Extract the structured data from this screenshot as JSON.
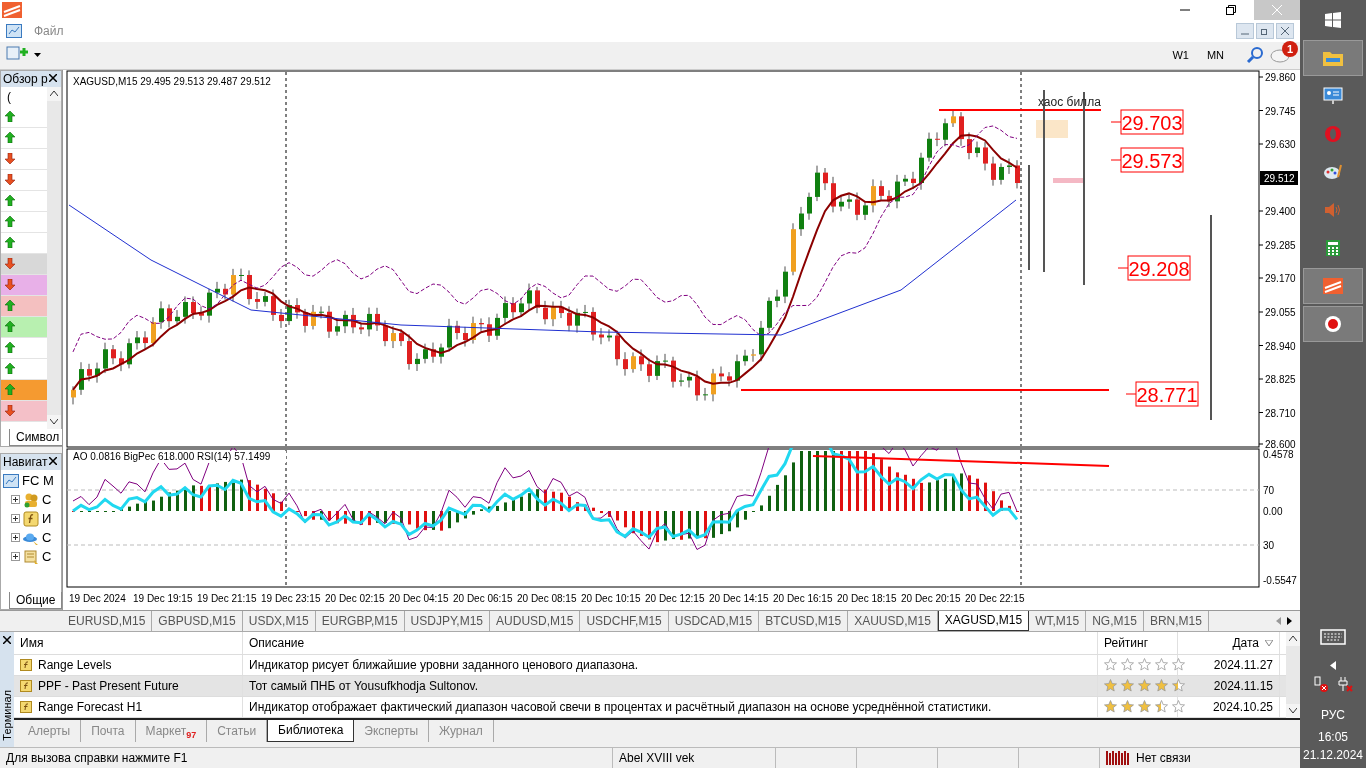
{
  "menu": [
    {
      "label": "Файл"
    }
  ],
  "toolbar": {
    "timeframes": [
      {
        "label": "W1",
        "selected": false
      },
      {
        "label": "MN",
        "selected": false
      }
    ],
    "notification_count": "1"
  },
  "market_watch": {
    "title": "Обзор р",
    "column_1": "(",
    "tab": "Символ",
    "rows": [
      {
        "kind": "up",
        "color": "#ffffff"
      },
      {
        "kind": "up",
        "color": "#ffffff"
      },
      {
        "kind": "down",
        "color": "#ffffff"
      },
      {
        "kind": "down",
        "color": "#ffffff"
      },
      {
        "kind": "up",
        "color": "#ffffff"
      },
      {
        "kind": "up",
        "color": "#ffffff"
      },
      {
        "kind": "up",
        "color": "#ffffff"
      },
      {
        "kind": "down",
        "color": "#d8d8d8"
      },
      {
        "kind": "down",
        "color": "#e8b0e8"
      },
      {
        "kind": "up",
        "color": "#f4c0c0"
      },
      {
        "kind": "up",
        "color": "#b8f0b0"
      },
      {
        "kind": "up",
        "color": "#ffffff"
      },
      {
        "kind": "up",
        "color": "#ffffff"
      },
      {
        "kind": "up",
        "color": "#f59a30"
      },
      {
        "kind": "down",
        "color": "#f4c0c8"
      }
    ]
  },
  "navigator": {
    "title": "Навигат",
    "tab": "Общие",
    "tree": [
      {
        "label": "FC M",
        "kind": "terminal",
        "children": [
          {
            "label": "С",
            "kind": "accounts",
            "expanded": false
          },
          {
            "label": "И",
            "kind": "indicators",
            "expanded": false
          },
          {
            "label": "С",
            "kind": "experts",
            "expanded": false
          },
          {
            "label": "С",
            "kind": "scripts",
            "expanded": false
          }
        ]
      }
    ]
  },
  "chart": {
    "header": "XAGUSD,M15  29.495 29.513 29.487 29.512",
    "price_ticks": [
      "29.860",
      "29.745",
      "29.630",
      "29.400",
      "29.285",
      "29.170",
      "29.055",
      "28.940",
      "28.825",
      "28.710",
      "28.600"
    ],
    "current_price": "29.512",
    "level_labels": [
      "29.703",
      "29.573",
      "29.208",
      "28.771"
    ],
    "annotation": "хаос билла",
    "indicator_header": "AO 0.0816  BigPec 618.000  RSI(14) 57.1499",
    "indicator_ticks": [
      "0.4578",
      "70",
      "0.00",
      "30",
      "-0.5547"
    ],
    "time_labels": [
      "19 Dec 2024",
      "19 Dec 19:15",
      "19 Dec 21:15",
      "19 Dec 23:15",
      "20 Dec 02:15",
      "20 Dec 04:15",
      "20 Dec 06:15",
      "20 Dec 08:15",
      "20 Dec 10:15",
      "20 Dec 12:15",
      "20 Dec 14:15",
      "20 Dec 16:15",
      "20 Dec 18:15",
      "20 Dec 20:15",
      "20 Dec 22:15"
    ]
  },
  "chart_tabs": [
    {
      "label": "EURUSD,M15",
      "selected": false
    },
    {
      "label": "GBPUSD,M15",
      "selected": false
    },
    {
      "label": "USDX,M15",
      "selected": false
    },
    {
      "label": "EURGBP,M15",
      "selected": false
    },
    {
      "label": "USDJPY,M15",
      "selected": false
    },
    {
      "label": "AUDUSD,M15",
      "selected": false
    },
    {
      "label": "USDCHF,M15",
      "selected": false
    },
    {
      "label": "USDCAD,M15",
      "selected": false
    },
    {
      "label": "BTCUSD,M15",
      "selected": false
    },
    {
      "label": "XAUUSD,M15",
      "selected": false
    },
    {
      "label": "XAGUSD,M15",
      "selected": true
    },
    {
      "label": "WT,M15",
      "selected": false
    },
    {
      "label": "NG,M15",
      "selected": false
    },
    {
      "label": "BRN,M15",
      "selected": false
    }
  ],
  "terminal": {
    "side_label": "Терминал",
    "columns": [
      "Имя",
      "Описание",
      "Рейтинг",
      "Дата"
    ],
    "rows": [
      {
        "name": "Range Levels",
        "description": "Индикатор рисует ближайшие уровни заданного ценового диапазона.",
        "stars": 0,
        "date": "2024.11.27",
        "selected": false
      },
      {
        "name": "PPF - Past Present Future",
        "description": "Тот самый ПНБ от Yousufkhodja Sultonov.",
        "stars": 4.5,
        "date": "2024.11.15",
        "selected": true
      },
      {
        "name": "Range Forecast H1",
        "description": "Индикатор отображает фактический диапазон часовой свечи в процентах и расчётный диапазон на основе усреднённой статистики.",
        "stars": 3.5,
        "date": "2024.10.25",
        "selected": false
      }
    ],
    "tabs": [
      {
        "label": "Алерты",
        "selected": false
      },
      {
        "label": "Почта",
        "selected": false
      },
      {
        "label": "Маркет",
        "badge": "97",
        "selected": false
      },
      {
        "label": "Статьи",
        "selected": false
      },
      {
        "label": "Библиотека",
        "selected": true
      },
      {
        "label": "Эксперты",
        "selected": false
      },
      {
        "label": "Журнал",
        "selected": false
      }
    ]
  },
  "status_bar": {
    "help": "Для вызова справки нажмите F1",
    "profile": "Abel XVIII vek",
    "connection": "Нет связи"
  },
  "taskbar": {
    "language": "РУС",
    "time": "16:05",
    "date": "21.12.2024"
  }
}
